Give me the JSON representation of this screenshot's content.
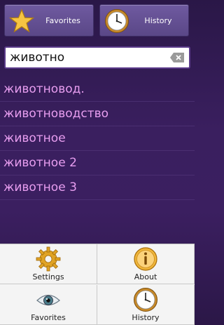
{
  "topbar": {
    "favorites": {
      "label": "Favorites",
      "icon": "star-icon"
    },
    "history": {
      "label": "History",
      "icon": "clock-icon"
    }
  },
  "search": {
    "value": "животно",
    "clear_icon": "backspace-clear-icon"
  },
  "results": [
    "животновод.",
    "животноводство",
    "животное",
    "животное 2",
    "животное 3"
  ],
  "menu": {
    "settings": {
      "label": "Settings",
      "icon": "gear-icon"
    },
    "about": {
      "label": "About",
      "icon": "info-icon"
    },
    "favorites": {
      "label": "Favorites",
      "icon": "eye-icon"
    },
    "history": {
      "label": "History",
      "icon": "clock-icon"
    }
  },
  "colors": {
    "background": "#3a1f5f",
    "result_text": "#e89ef0",
    "button_purple": "#6f5aa0"
  }
}
